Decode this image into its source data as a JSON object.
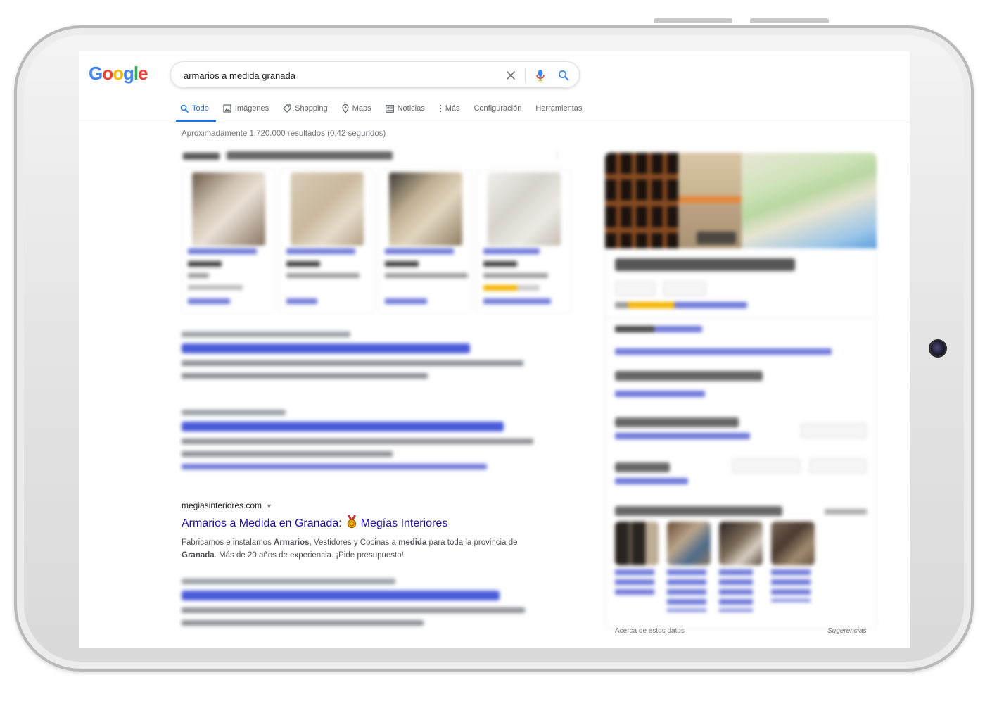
{
  "search": {
    "query": "armarios a medida granada"
  },
  "logo": [
    "G",
    "o",
    "o",
    "g",
    "l",
    "e"
  ],
  "colors": {
    "google_blue": "#4285F4",
    "google_red": "#EA4335",
    "google_yellow": "#FBBC05",
    "google_green": "#34A853",
    "link": "#1a0dab",
    "accent": "#1a73e8"
  },
  "tabs": [
    {
      "label": "Todo",
      "icon": "search-icon",
      "active": true
    },
    {
      "label": "Imágenes",
      "icon": "image-icon"
    },
    {
      "label": "Shopping",
      "icon": "tag-icon"
    },
    {
      "label": "Maps",
      "icon": "map-pin-icon"
    },
    {
      "label": "Noticias",
      "icon": "news-icon"
    },
    {
      "label": "Más",
      "icon": "more-vertical-icon"
    }
  ],
  "tools": {
    "settings": "Configuración",
    "tools": "Herramientas"
  },
  "stats": "Aproximadamente 1.720.000 resultados (0,42 segundos)",
  "featured_result": {
    "domain": "megiasinteriores.com",
    "title_prefix": "Armarios a Medida en Granada:",
    "title_suffix": "Megías Interiores",
    "snippet": [
      {
        "text": "Fabricamos e instalamos "
      },
      {
        "text": "Armarios",
        "bold": true
      },
      {
        "text": ", Vestidores y Cocinas a "
      },
      {
        "text": "medida",
        "bold": true
      },
      {
        "text": " para toda la provincia de "
      },
      {
        "text": "Granada",
        "bold": true
      },
      {
        "text": ". Más de 20 años de experiencia. ¡Pide presupuesto!"
      }
    ]
  },
  "knowledge_panel": {
    "footer_left": "Acerca de estos datos",
    "footer_right": "Sugerencias"
  }
}
